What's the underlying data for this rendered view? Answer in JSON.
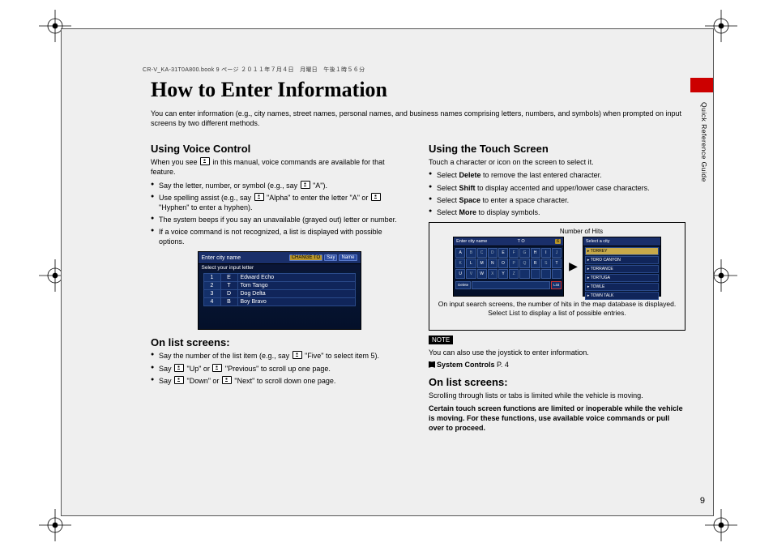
{
  "header_line": "CR-V_KA-31T0A800.book  9 ページ  ２０１１年７月４日　月曜日　午後１時５６分",
  "side_label": "Quick Reference Guide",
  "page_number": "9",
  "title": "How to Enter Information",
  "intro": "You can enter information (e.g., city names, street names, personal names, and business names comprising letters, numbers, and symbols) when prompted on input screens by two different methods.",
  "left": {
    "h_voice": "Using Voice Control",
    "voice_intro_a": "When you see ",
    "voice_intro_b": " in this manual, voice commands are available for that feature.",
    "bullets": [
      "Say the letter, number, or symbol (e.g., say [v] \"A\").",
      "Use spelling assist (e.g., say [v] \"Alpha\" to enter the letter \"A\" or [v] \"Hyphen\" to enter a hyphen).",
      "The system beeps if you say an unavailable (grayed out) letter or number.",
      "If a voice command is not recognized, a list is displayed with possible options."
    ],
    "ss1": {
      "title": "Enter city name",
      "btn_change": "CHANGE TO",
      "btn_say": "Say",
      "btn_name": "Name",
      "sub": "Select your input letter",
      "rows": [
        {
          "n": "1",
          "l": "E",
          "w": "Edward Echo"
        },
        {
          "n": "2",
          "l": "T",
          "w": "Tom Tango"
        },
        {
          "n": "3",
          "l": "D",
          "w": "Dog Delta"
        },
        {
          "n": "4",
          "l": "B",
          "w": "Boy Bravo"
        }
      ]
    },
    "h_list": "On list screens:",
    "list_bullets": [
      "Say the number of the list item (e.g., say [v] \"Five\" to select item 5).",
      "Say [v] \"Up\" or [v] \"Previous\" to scroll up one page.",
      "Say [v] \"Down\" or [v] \"Next\" to scroll down one page."
    ]
  },
  "right": {
    "h_touch": "Using the Touch Screen",
    "touch_intro": "Touch a character or icon on the screen to select it.",
    "bullets": [
      {
        "pre": "Select ",
        "b": "Delete",
        "post": " to remove the last entered character."
      },
      {
        "pre": "Select ",
        "b": "Shift",
        "post": " to display accented and upper/lower case characters."
      },
      {
        "pre": "Select ",
        "b": "Space",
        "post": " to enter a space character."
      },
      {
        "pre": "Select ",
        "b": "More",
        "post": " to display symbols."
      }
    ],
    "hits_label": "Number of Hits",
    "ss2a": {
      "title": "Enter city name",
      "entry": "T O",
      "hits": "6",
      "bottom": {
        "delete": "Delete",
        "more": "",
        "list": "List"
      }
    },
    "ss2b": {
      "title": "Select a city",
      "rows": [
        "TORREY",
        "TORO CANYON",
        "TORRANCE",
        "TORTUGA",
        "TOWLE",
        "TOWN TALK"
      ]
    },
    "ss2_caption": "On input search screens, the number of hits in the map database is displayed. Select List to display a list of possible entries.",
    "note_tag": "NOTE",
    "note_text": "You can also use the joystick to enter information.",
    "ref_label": "System Controls",
    "ref_page": "P. 4",
    "h_list": "On list screens:",
    "list_intro": "Scrolling through lists or tabs is limited while the vehicle is moving.",
    "list_bold": "Certain touch screen functions are limited or inoperable while the vehicle is moving. For these functions, use available voice commands or pull over to proceed."
  }
}
